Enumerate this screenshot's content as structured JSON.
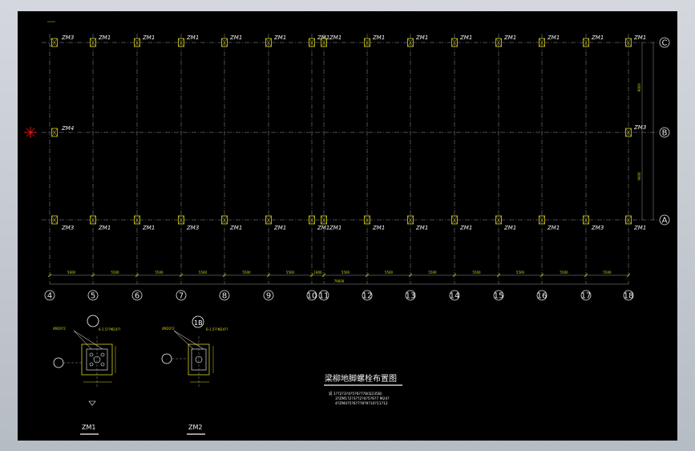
{
  "drawing": {
    "title": "梁柳地脚螺栓布置图",
    "notes": [
      "说  1??2?3?4?5?6?7?8(Q235B)",
      "3?ZM1?2?3??2?4?5?6?7 M24?",
      "4?ZM4?5?6?7?8?9?10?11?12"
    ],
    "detail_labels": [
      "ZM1",
      "ZM2"
    ],
    "detail_circle_label": "1B",
    "detail_callout": "4M20?2",
    "detail_dim_label": "6-1.5??M24??"
  },
  "grid": {
    "col_labels": [
      "4",
      "5",
      "6",
      "7",
      "8",
      "9",
      "10",
      "11",
      "12",
      "13",
      "14",
      "15",
      "16",
      "17",
      "18"
    ],
    "row_labels": [
      "C",
      "B",
      "A"
    ],
    "total_dim": "79600",
    "bay_dims": [
      "5600",
      "5500",
      "5500",
      "5500",
      "5500",
      "5500",
      "1800",
      "5500",
      "5500",
      "5500",
      "5500",
      "5500",
      "5500",
      "5500"
    ],
    "right_dims": [
      "9000",
      "9000"
    ]
  },
  "markers": {
    "top_row": [
      "ZM3",
      "ZM1",
      "ZM1",
      "ZM1",
      "ZM1",
      "ZM1",
      "ZM1",
      "ZM1",
      "ZM1",
      "ZM1",
      "ZM1",
      "ZM1",
      "ZM1",
      "ZM1",
      "ZM1"
    ],
    "mid_row": [
      "ZM4",
      "ZM3"
    ],
    "bottom_row": [
      "ZM3",
      "ZM1",
      "ZM1",
      "ZM3",
      "ZM1",
      "ZM1",
      "ZM1",
      "ZM1",
      "ZM1",
      "ZM1",
      "ZM1",
      "ZM1",
      "ZM1",
      "ZM3",
      "ZM1"
    ]
  },
  "colors": {
    "grid_line": "#9a9a9a",
    "marker": "#d8d21a",
    "text": "#f2f2f2",
    "dim": "#d7d41a",
    "arrow": "#e21b1b"
  }
}
